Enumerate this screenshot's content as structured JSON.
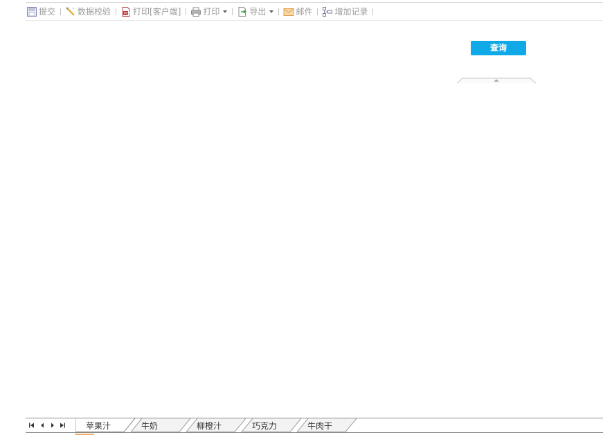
{
  "toolbar": {
    "items": [
      {
        "label": "提交",
        "icon": "save-icon"
      },
      {
        "label": "数据校验",
        "icon": "validate-icon"
      },
      {
        "label": "打印[客户端]",
        "icon": "pdf-print-icon"
      },
      {
        "label": "打印",
        "icon": "printer-icon"
      },
      {
        "label": "导出",
        "icon": "export-icon"
      },
      {
        "label": "邮件",
        "icon": "mail-icon"
      },
      {
        "label": "增加记录",
        "icon": "add-record-icon"
      }
    ]
  },
  "query": {
    "button_label": "查询"
  },
  "sheets": {
    "nav_icons": [
      "first-sheet-icon",
      "prev-sheet-icon",
      "next-sheet-icon",
      "last-sheet-icon"
    ],
    "tabs": [
      {
        "label": "苹果汁",
        "active": true
      },
      {
        "label": "牛奶",
        "active": false
      },
      {
        "label": "柳橙汁",
        "active": false
      },
      {
        "label": "巧克力",
        "active": false
      },
      {
        "label": "牛肉干",
        "active": false
      }
    ]
  },
  "colors": {
    "accent": "#0ea9e6",
    "toolbar_text": "#9a9a9a"
  }
}
